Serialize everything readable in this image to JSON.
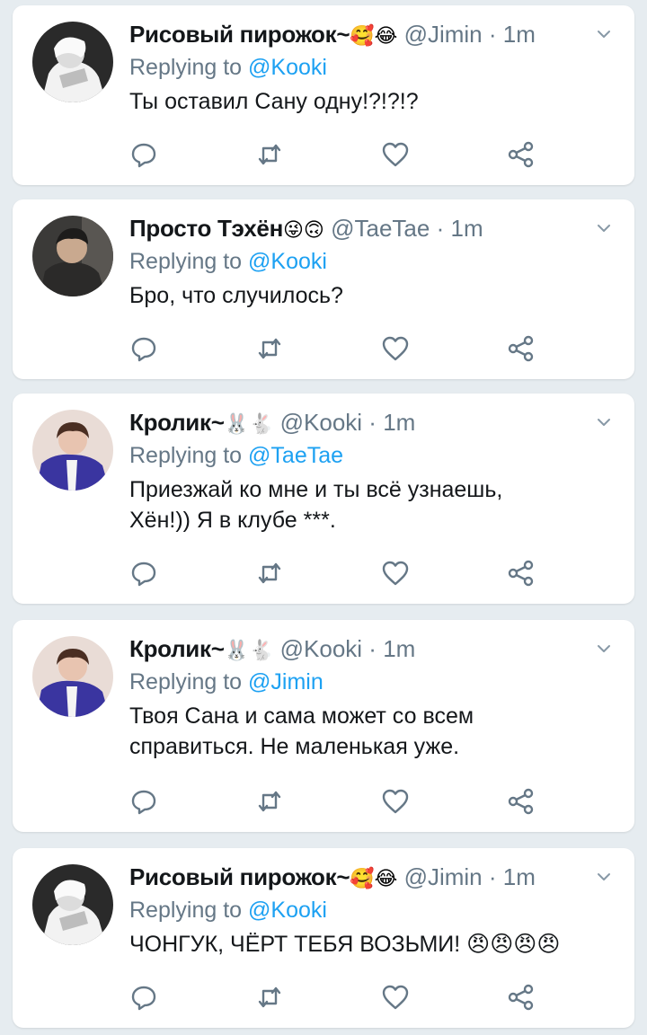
{
  "colors": {
    "background": "#e6ecf0",
    "card": "#ffffff",
    "name": "#14171a",
    "secondary": "#657786",
    "mention": "#1da1f2"
  },
  "tweets": [
    {
      "name": "Рисовый пирожок~",
      "name_emoji": "🥰😂",
      "handle": "@Jimin",
      "separator": "·",
      "time": "1m",
      "reply_prefix": "Replying to ",
      "reply_to": "@Kooki",
      "text": "Ты оставил Сану одну!?!?!?",
      "avatar": "avatar-jimin"
    },
    {
      "name": "Просто Тэхён",
      "name_emoji": "😜🙃",
      "handle": "@TaeTae",
      "separator": "·",
      "time": "1m",
      "reply_prefix": "Replying to ",
      "reply_to": "@Kooki",
      "text": "Бро, что случилось?",
      "avatar": "avatar-taetae"
    },
    {
      "name": "Кролик~",
      "name_emoji": "🐰🐇",
      "handle": "@Kooki",
      "separator": "·",
      "time": "1m",
      "reply_prefix": "Replying to ",
      "reply_to": "@TaeTae",
      "text": "Приезжай ко мне и ты всё узнаешь,\nХён!)) Я в клубе ***.",
      "avatar": "avatar-kooki"
    },
    {
      "name": "Кролик~",
      "name_emoji": "🐰🐇",
      "handle": "@Kooki",
      "separator": "·",
      "time": "1m",
      "reply_prefix": "Replying to ",
      "reply_to": "@Jimin",
      "text": "Твоя Сана и сама может со всем\nсправиться. Не маленькая уже.",
      "avatar": "avatar-kooki"
    },
    {
      "name": "Рисовый пирожок~",
      "name_emoji": "🥰😂",
      "handle": "@Jimin",
      "separator": "·",
      "time": "1m",
      "reply_prefix": "Replying to ",
      "reply_to": "@Kooki",
      "text": "ЧОНГУК, ЧЁРТ ТЕБЯ ВОЗЬМИ! 😠😠😠😠",
      "avatar": "avatar-jimin"
    }
  ],
  "actions": [
    "reply-icon",
    "retweet-icon",
    "like-icon",
    "share-icon"
  ],
  "menu_icon": "chevron-down-icon"
}
